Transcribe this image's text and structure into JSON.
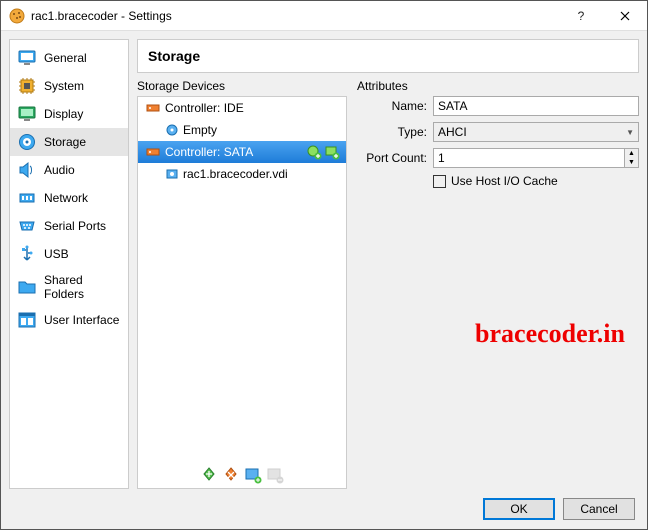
{
  "title": "rac1.bracecoder - Settings",
  "sidebar": {
    "items": [
      {
        "label": "General"
      },
      {
        "label": "System"
      },
      {
        "label": "Display"
      },
      {
        "label": "Storage"
      },
      {
        "label": "Audio"
      },
      {
        "label": "Network"
      },
      {
        "label": "Serial Ports"
      },
      {
        "label": "USB"
      },
      {
        "label": "Shared Folders"
      },
      {
        "label": "User Interface"
      }
    ]
  },
  "header": "Storage",
  "storage": {
    "panel_label": "Storage Devices",
    "controller_ide": "Controller: IDE",
    "ide_empty": "Empty",
    "controller_sata": "Controller: SATA",
    "sata_disk": "rac1.bracecoder.vdi"
  },
  "attributes": {
    "panel_label": "Attributes",
    "name_label": "Name:",
    "name_value": "SATA",
    "type_label": "Type:",
    "type_value": "AHCI",
    "port_label": "Port Count:",
    "port_value": "1",
    "cache_label": "Use Host I/O Cache"
  },
  "watermark": "bracecoder.in",
  "buttons": {
    "ok": "OK",
    "cancel": "Cancel"
  }
}
